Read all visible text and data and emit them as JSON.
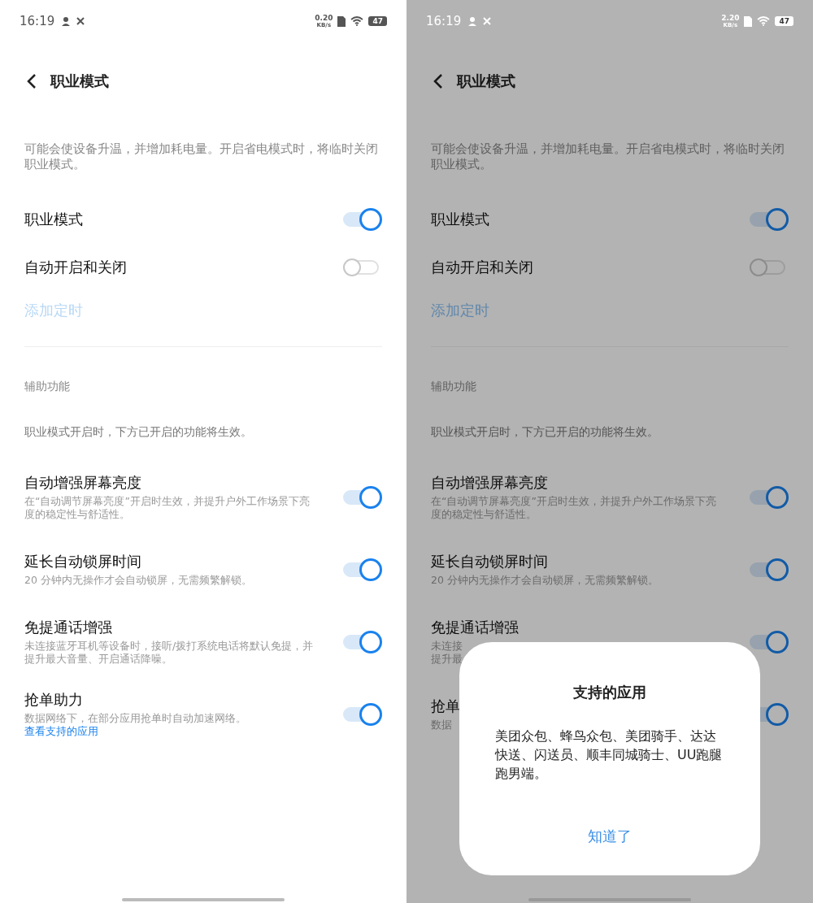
{
  "screens": [
    {
      "dimmed": false,
      "status_bar": {
        "time": "16:19",
        "speed": "0.20",
        "speed_unit": "KB/s",
        "battery": "47"
      },
      "title": "职业模式",
      "warning": "可能会使设备升温，并增加耗电量。开启省电模式时，将临时关闭职业模式。",
      "switches": [
        {
          "label": "职业模式",
          "on": true
        },
        {
          "label": "自动开启和关闭",
          "on": false
        }
      ],
      "add_schedule": {
        "label": "添加定时",
        "disabled": true
      },
      "section_title": "辅助功能",
      "section_note": "职业模式开启时，下方已开启的功能将生效。",
      "features": [
        {
          "title": "自动增强屏幕亮度",
          "description": "在“自动调节屏幕亮度”开启时生效，并提升户外工作场景下亮度的稳定性与舒适性。",
          "on": true
        },
        {
          "title": "延长自动锁屏时间",
          "description": "20 分钟内无操作才会自动锁屏，无需频繁解锁。",
          "on": true
        },
        {
          "title": "免提通话增强",
          "description": "未连接蓝牙耳机等设备时，接听/拨打系统电话将默认免提，并提升最大音量、开启通话降噪。",
          "on": true
        },
        {
          "title": "抢单助力",
          "description": "数据网络下，在部分应用抢单时自动加速网络。",
          "link": "查看支持的应用",
          "on": true
        }
      ]
    },
    {
      "dimmed": true,
      "status_bar": {
        "time": "16:19",
        "speed": "2.20",
        "speed_unit": "KB/s",
        "battery": "47"
      },
      "title": "职业模式",
      "warning": "可能会使设备升温，并增加耗电量。开启省电模式时，将临时关闭职业模式。",
      "switches": [
        {
          "label": "职业模式",
          "on": true
        },
        {
          "label": "自动开启和关闭",
          "on": false
        }
      ],
      "add_schedule": {
        "label": "添加定时",
        "disabled": true
      },
      "section_title": "辅助功能",
      "section_note": "职业模式开启时，下方已开启的功能将生效。",
      "features": [
        {
          "title": "自动增强屏幕亮度",
          "description": "在“自动调节屏幕亮度”开启时生效，并提升户外工作场景下亮度的稳定性与舒适性。",
          "on": true
        },
        {
          "title": "延长自动锁屏时间",
          "description": "20 分钟内无操作才会自动锁屏，无需频繁解锁。",
          "on": true
        },
        {
          "title": "免提通话增强",
          "description_lines": [
            "未连接",
            "提升最"
          ],
          "on": true
        },
        {
          "title": "抢单",
          "description": "数据",
          "on": true
        }
      ],
      "dialog": {
        "title": "支持的应用",
        "body": "美团众包、蜂鸟众包、美团骑手、达达快送、闪送员、顺丰同城骑士、UU跑腿跑男端。",
        "button": "知道了"
      }
    }
  ]
}
